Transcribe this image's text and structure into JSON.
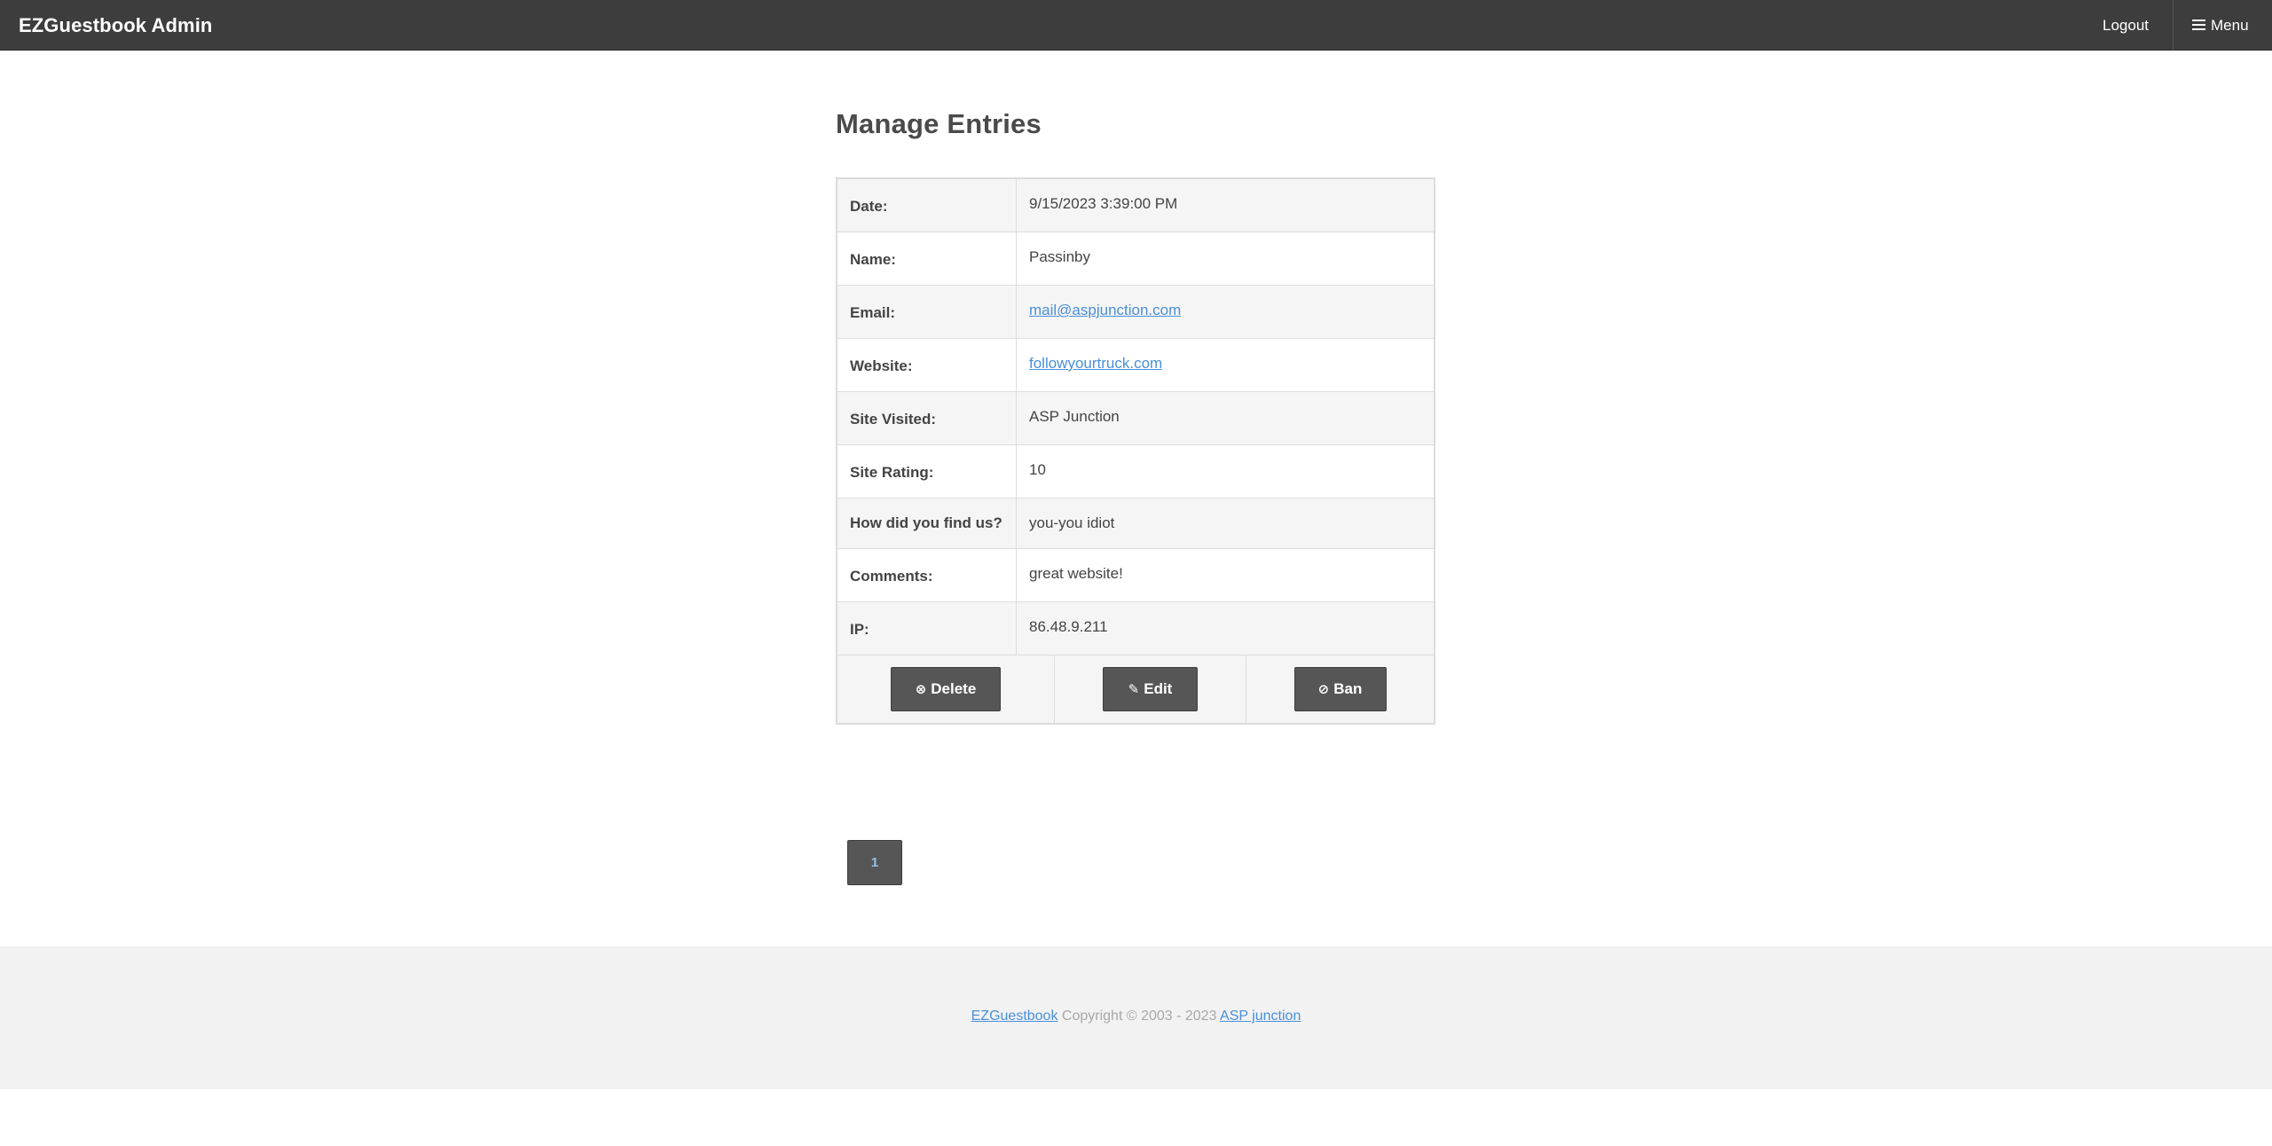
{
  "header": {
    "brand": "EZGuestbook Admin",
    "logout_label": "Logout",
    "menu_label": "Menu"
  },
  "page": {
    "title": "Manage Entries"
  },
  "entry": {
    "rows": [
      {
        "label": "Date:",
        "value": "9/15/2023 3:39:00 PM"
      },
      {
        "label": "Name:",
        "value": "Passinby"
      },
      {
        "label": "Email:",
        "value": "mail@aspjunction.com"
      },
      {
        "label": "Website:",
        "value": "followyourtruck.com"
      },
      {
        "label": "Site Visited:",
        "value": "ASP Junction"
      },
      {
        "label": "Site Rating:",
        "value": "10"
      },
      {
        "label": "How did you find us?",
        "value": "you-you idiot"
      },
      {
        "label": "Comments:",
        "value": "great website!"
      },
      {
        "label": "IP:",
        "value": "86.48.9.211"
      }
    ],
    "actions": {
      "delete_label": "Delete",
      "edit_label": "Edit",
      "ban_label": "Ban"
    }
  },
  "pagination": {
    "current_page": "1"
  },
  "footer": {
    "product_link": "EZGuestbook",
    "copyright": "Copyright © 2003 - 2023",
    "company_link": "ASP junction"
  },
  "colors": {
    "topbar": "#3d3d3d",
    "button": "#565656",
    "link": "#4a90d9",
    "footer_bg": "#f2f2f2"
  }
}
